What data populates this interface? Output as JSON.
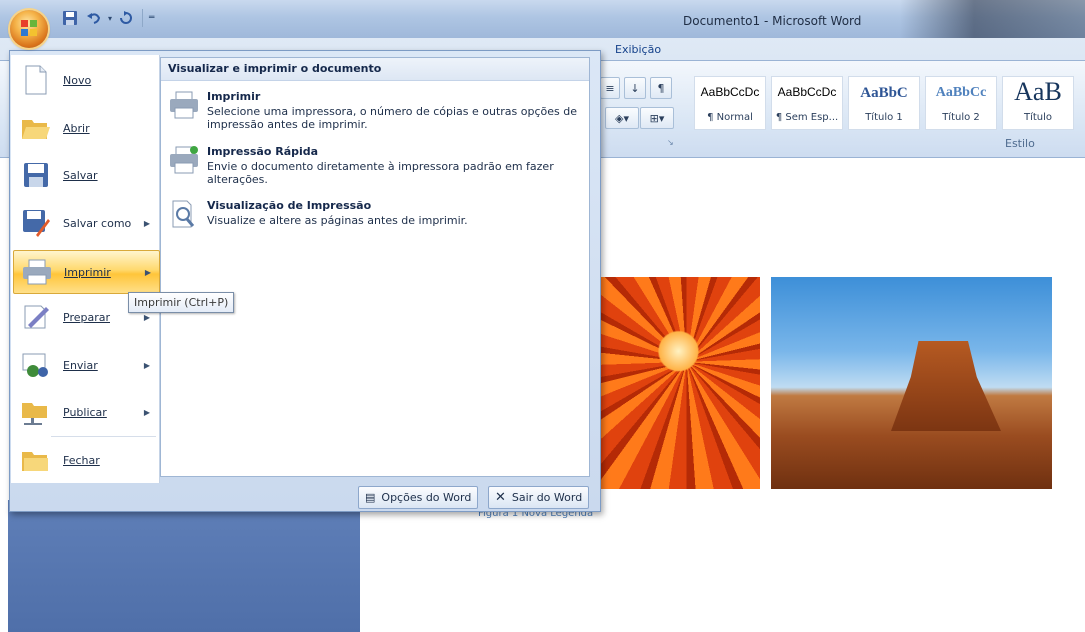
{
  "window": {
    "title": "Documento1 - Microsoft Word"
  },
  "quick_access": {
    "icons": [
      "save-icon",
      "undo-icon",
      "redo-icon",
      "customize-qat-icon"
    ]
  },
  "ribbon": {
    "tab_visible": "Exibição",
    "styles": [
      {
        "sample": "AaBbCcDc",
        "name": "¶ Normal"
      },
      {
        "sample": "AaBbCcDc",
        "name": "¶ Sem Esp..."
      },
      {
        "sample": "AaBbC",
        "name": "Título 1"
      },
      {
        "sample": "AaBbCc",
        "name": "Título 2"
      },
      {
        "sample": "AaB",
        "name": "Título"
      }
    ],
    "group_label": "Estilo"
  },
  "office_menu": {
    "items": [
      {
        "label": "Novo",
        "icon": "new-document-icon",
        "has_arrow": false
      },
      {
        "label": "Abrir",
        "icon": "open-folder-icon",
        "has_arrow": false
      },
      {
        "label": "Salvar",
        "icon": "save-icon",
        "has_arrow": false
      },
      {
        "label": "Salvar como",
        "icon": "save-as-icon",
        "has_arrow": true
      },
      {
        "label": "Imprimir",
        "icon": "printer-icon",
        "has_arrow": true,
        "highlighted": true
      },
      {
        "label": "Preparar",
        "icon": "prepare-icon",
        "has_arrow": true
      },
      {
        "label": "Enviar",
        "icon": "send-icon",
        "has_arrow": true
      },
      {
        "label": "Publicar",
        "icon": "publish-icon",
        "has_arrow": true
      },
      {
        "label": "Fechar",
        "icon": "close-folder-icon",
        "has_arrow": false
      }
    ],
    "submenu": {
      "header": "Visualizar e imprimir o documento",
      "items": [
        {
          "title": "Imprimir",
          "desc": "Selecione uma impressora, o número de cópias e outras opções de impressão antes de imprimir."
        },
        {
          "title": "Impressão Rápida",
          "desc": "Envie o documento diretamente à impressora padrão em fazer alterações."
        },
        {
          "title": "Visualização de Impressão",
          "desc": "Visualize e altere as páginas antes de imprimir."
        }
      ]
    },
    "bottom": {
      "options_label": "Opções do Word",
      "exit_label": "Sair do Word"
    },
    "tooltip": "Imprimir (Ctrl+P)"
  },
  "document": {
    "caption": "Figura 1 Nova Legenda"
  }
}
